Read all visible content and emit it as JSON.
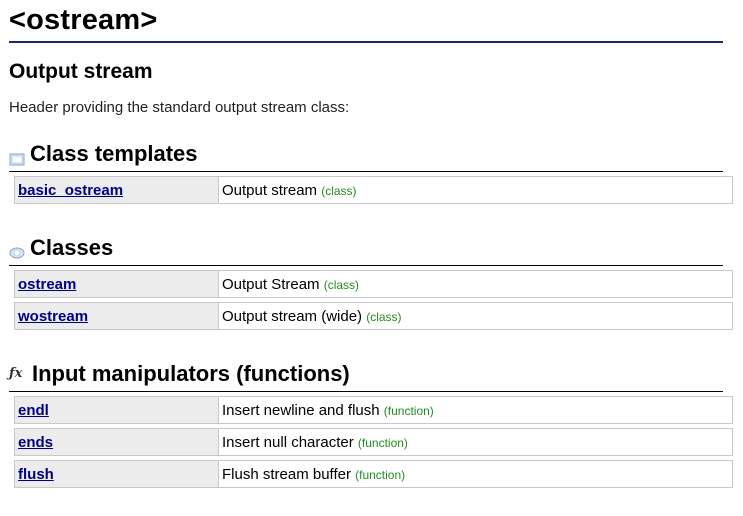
{
  "header": {
    "title": "<ostream>",
    "subtitle": "Output stream",
    "description": "Header providing the standard output stream class:"
  },
  "sections": [
    {
      "heading": "Class templates",
      "icon": "class-template-icon",
      "items": [
        {
          "name": "basic_ostream",
          "description": "Output stream",
          "kind": "(class)"
        }
      ]
    },
    {
      "heading": "Classes",
      "icon": "class-icon",
      "items": [
        {
          "name": "ostream",
          "description": "Output Stream",
          "kind": "(class)"
        },
        {
          "name": "wostream",
          "description": "Output stream (wide)",
          "kind": "(class)"
        }
      ]
    },
    {
      "heading": "Input manipulators (functions)",
      "icon": "function-icon",
      "items": [
        {
          "name": "endl",
          "description": "Insert newline and flush",
          "kind": "(function)"
        },
        {
          "name": "ends",
          "description": "Insert null character",
          "kind": "(function)"
        },
        {
          "name": "flush",
          "description": "Flush stream buffer",
          "kind": "(function)"
        }
      ]
    }
  ],
  "colors": {
    "title_rule": "#1b2a66",
    "link": "#000080",
    "kind": "#228b22",
    "name_cell_bg": "#ececec"
  }
}
